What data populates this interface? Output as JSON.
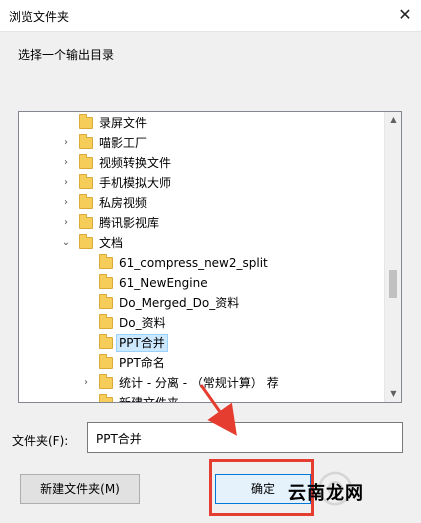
{
  "window": {
    "title": "浏览文件夹",
    "close_glyph": "✕"
  },
  "prompt": "选择一个输出目录",
  "tree": {
    "items": [
      {
        "label": "录屏文件",
        "depth": 1,
        "expander": ""
      },
      {
        "label": "喵影工厂",
        "depth": 1,
        "expander": ">"
      },
      {
        "label": "视频转换文件",
        "depth": 1,
        "expander": ">"
      },
      {
        "label": "手机模拟大师",
        "depth": 1,
        "expander": ">"
      },
      {
        "label": "私房视频",
        "depth": 1,
        "expander": ">"
      },
      {
        "label": "腾讯影视库",
        "depth": 1,
        "expander": ">"
      },
      {
        "label": "文档",
        "depth": 1,
        "expander": "v"
      },
      {
        "label": "61_compress_new2_split",
        "depth": 2,
        "expander": ""
      },
      {
        "label": "61_NewEngine",
        "depth": 2,
        "expander": ""
      },
      {
        "label": "Do_Merged_Do_资料",
        "depth": 2,
        "expander": ""
      },
      {
        "label": "Do_资料",
        "depth": 2,
        "expander": ""
      },
      {
        "label": "PPT合并",
        "depth": 2,
        "expander": "",
        "selected": true
      },
      {
        "label": "PPT命名",
        "depth": 2,
        "expander": ""
      },
      {
        "label": "统计 - 分离 - （常规计算） 荐",
        "depth": 2,
        "expander": ">"
      },
      {
        "label": "新建文件夹",
        "depth": 2,
        "expander": ""
      }
    ]
  },
  "folder_field": {
    "label": "文件夹(F):",
    "value": "PPT合并"
  },
  "buttons": {
    "new_folder": "新建文件夹(M)",
    "ok": "确定"
  },
  "watermark": "云南龙网",
  "colors": {
    "highlight_box": "#e53d2f",
    "folder_icon": "#f6cd58",
    "selection": "#cce8ff"
  }
}
